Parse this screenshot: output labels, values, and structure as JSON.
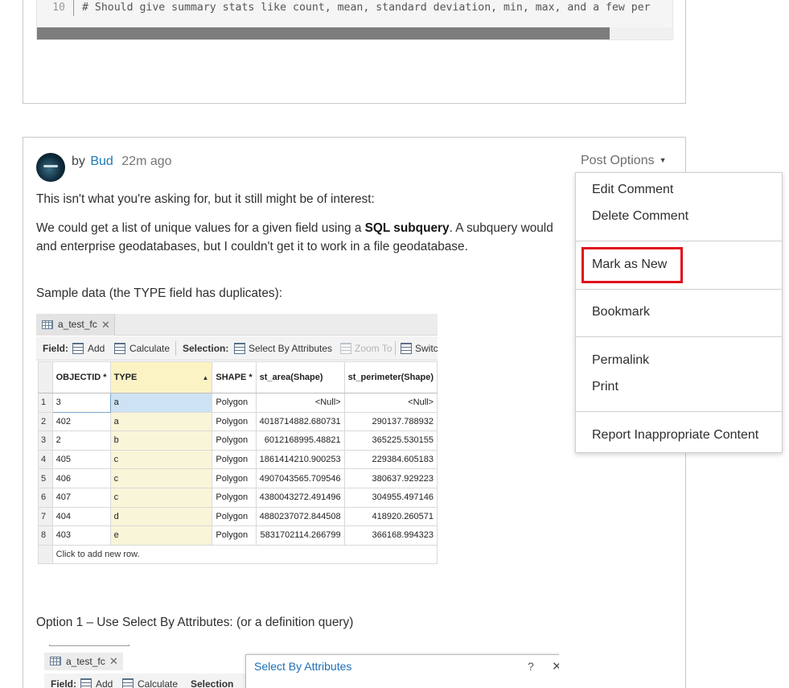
{
  "code_block": {
    "line_number": "10",
    "line_text": "# Should give summary stats like count, mean, standard deviation, min, max, and a few per"
  },
  "post": {
    "by_prefix": "by",
    "author": "Bud",
    "time": "22m ago",
    "options_label": "Post Options",
    "caret": "▼",
    "para1": "This isn't what you're asking for, but it still might be of interest:",
    "para2_a": "We could get a list of unique values for a given field using a ",
    "para2_bold": "SQL subquery",
    "para2_b": ". A subquery would",
    "para3": "and enterprise geodatabases, but I couldn't get it to work in a file geodatabase.",
    "para4": "Sample data (the TYPE field has duplicates):",
    "para5": "Option 1 – Use Select By Attributes: (or a definition query)"
  },
  "table_window": {
    "tab_label": "a_test_fc",
    "close_glyph": "✕",
    "toolbar": {
      "field_label": "Field:",
      "add": "Add",
      "calculate": "Calculate",
      "selection_label": "Selection:",
      "select_by_attributes": "Select By Attributes",
      "zoom_to": "Zoom To",
      "switch": "Switc"
    },
    "columns": [
      "OBJECTID *",
      "TYPE",
      "SHAPE *",
      "st_area(Shape)",
      "st_perimeter(Shape)"
    ],
    "rows": [
      {
        "n": "1",
        "oid": "3",
        "type": "a",
        "shape": "Polygon",
        "area": "<Null>",
        "perim": "<Null>"
      },
      {
        "n": "2",
        "oid": "402",
        "type": "a",
        "shape": "Polygon",
        "area": "4018714882.680731",
        "perim": "290137.788932"
      },
      {
        "n": "3",
        "oid": "2",
        "type": "b",
        "shape": "Polygon",
        "area": "6012168995.48821",
        "perim": "365225.530155"
      },
      {
        "n": "4",
        "oid": "405",
        "type": "c",
        "shape": "Polygon",
        "area": "1861414210.900253",
        "perim": "229384.605183"
      },
      {
        "n": "5",
        "oid": "406",
        "type": "c",
        "shape": "Polygon",
        "area": "4907043565.709546",
        "perim": "380637.929223"
      },
      {
        "n": "6",
        "oid": "407",
        "type": "c",
        "shape": "Polygon",
        "area": "4380043272.491496",
        "perim": "304955.497146"
      },
      {
        "n": "7",
        "oid": "404",
        "type": "d",
        "shape": "Polygon",
        "area": "4880237072.844508",
        "perim": "418920.260571"
      },
      {
        "n": "8",
        "oid": "403",
        "type": "e",
        "shape": "Polygon",
        "area": "5831702114.266799",
        "perim": "366168.994323"
      }
    ],
    "add_row_text": "Click to add new row."
  },
  "table_window_2": {
    "tab_label": "a_test_fc",
    "close_glyph": "✕",
    "field_label": "Field:",
    "add": "Add",
    "calculate": "Calculate",
    "selection_label": "Selection",
    "dialog_title": "Select By Attributes",
    "dialog_help": "?",
    "dialog_close": "✕"
  },
  "menu": {
    "items": {
      "edit_comment": "Edit Comment",
      "delete_comment": "Delete Comment",
      "mark_as_new": "Mark as New",
      "bookmark": "Bookmark",
      "permalink": "Permalink",
      "print": "Print",
      "report": "Report Inappropriate Content"
    },
    "highlight_color": "#e0101c"
  },
  "colors": {
    "link": "#1a7bb5",
    "type_column": "#f9f5d9",
    "selected_cell": "#cde3f3",
    "dialog_title": "#1e6fb8"
  }
}
